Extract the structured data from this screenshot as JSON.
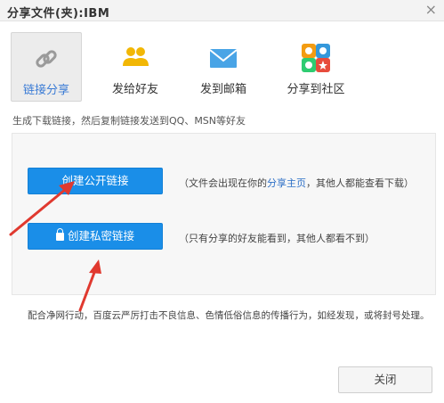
{
  "window": {
    "title": "分享文件(夹):IBM",
    "close_glyph": "×"
  },
  "tabs": [
    {
      "label": "链接分享",
      "icon": "link-icon",
      "active": true
    },
    {
      "label": "发给好友",
      "icon": "friends-icon",
      "active": false
    },
    {
      "label": "发到邮箱",
      "icon": "mail-icon",
      "active": false
    },
    {
      "label": "分享到社区",
      "icon": "community-icon",
      "active": false
    }
  ],
  "hint": "生成下载链接，然后复制链接发送到QQ、MSN等好友",
  "public_link": {
    "button_label": "创建公开链接",
    "desc_before": "（文件会出现在你的",
    "desc_link": "分享主页",
    "desc_after": "，其他人都能查看下载）"
  },
  "private_link": {
    "button_label": "创建私密链接",
    "desc": "（只有分享的好友能看到，其他人都看不到）"
  },
  "notice": "配合净网行动，百度云严厉打击不良信息、色情低俗信息的传播行为，如经发现，或将封号处理。",
  "footer": {
    "close_label": "关闭"
  },
  "colors": {
    "accent": "#1a8ee8",
    "link": "#2c6fc6",
    "annotation_arrow": "#e0392f"
  }
}
